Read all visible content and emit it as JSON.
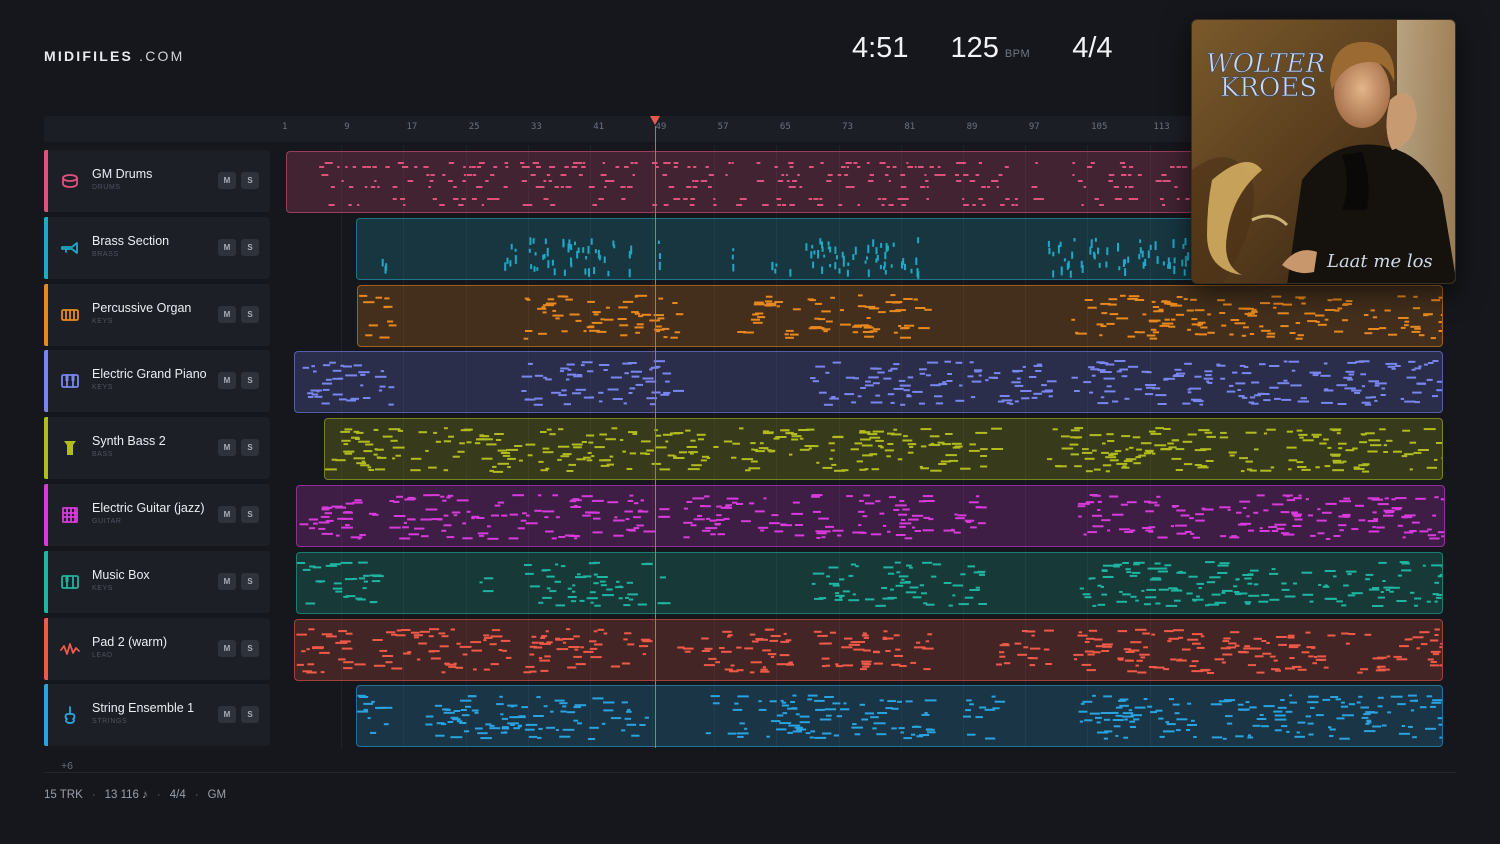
{
  "logo": {
    "brand": "MIDIFILES",
    "tld": ".COM"
  },
  "header": {
    "duration": "4:51",
    "bpm": "125",
    "bpm_unit": "BPM",
    "time_signature": "4/4"
  },
  "ruler": {
    "marks": [
      "1",
      "9",
      "17",
      "25",
      "33",
      "41",
      "49",
      "57",
      "65",
      "73",
      "81",
      "89",
      "97",
      "105",
      "113"
    ]
  },
  "tracks": [
    {
      "name": "GM Drums",
      "category": "DRUMS",
      "color": "#e0527e",
      "icon": "drum-icon",
      "mute": "M",
      "solo": "S"
    },
    {
      "name": "Brass Section",
      "category": "BRASS",
      "color": "#1fa9c6",
      "icon": "trumpet-icon",
      "mute": "M",
      "solo": "S"
    },
    {
      "name": "Percussive Organ",
      "category": "KEYS",
      "color": "#e8891f",
      "icon": "organ-icon",
      "mute": "M",
      "solo": "S"
    },
    {
      "name": "Electric Grand Piano",
      "category": "KEYS",
      "color": "#7a86f0",
      "icon": "piano-icon",
      "mute": "M",
      "solo": "S"
    },
    {
      "name": "Synth Bass 2",
      "category": "BASS",
      "color": "#b1bd1f",
      "icon": "bass-icon",
      "mute": "M",
      "solo": "S"
    },
    {
      "name": "Electric Guitar (jazz)",
      "category": "GUITAR",
      "color": "#d83bdc",
      "icon": "guitar-icon",
      "mute": "M",
      "solo": "S"
    },
    {
      "name": "Music Box",
      "category": "KEYS",
      "color": "#1fb5a0",
      "icon": "music-box-icon",
      "mute": "M",
      "solo": "S"
    },
    {
      "name": "Pad 2 (warm)",
      "category": "LEAD",
      "color": "#ef5a48",
      "icon": "waveform-icon",
      "mute": "M",
      "solo": "S"
    },
    {
      "name": "String Ensemble 1",
      "category": "STRINGS",
      "color": "#2aa3e0",
      "icon": "violin-icon",
      "mute": "M",
      "solo": "S"
    }
  ],
  "playhead": {
    "bar": 49
  },
  "album": {
    "artist": "WOLTER KROES",
    "title": "Laat me los"
  },
  "more_tracks": "+6",
  "footer": {
    "tracks": "15 TRK",
    "notes": "13 116 ♪",
    "meter": "4/4",
    "standard": "GM"
  }
}
